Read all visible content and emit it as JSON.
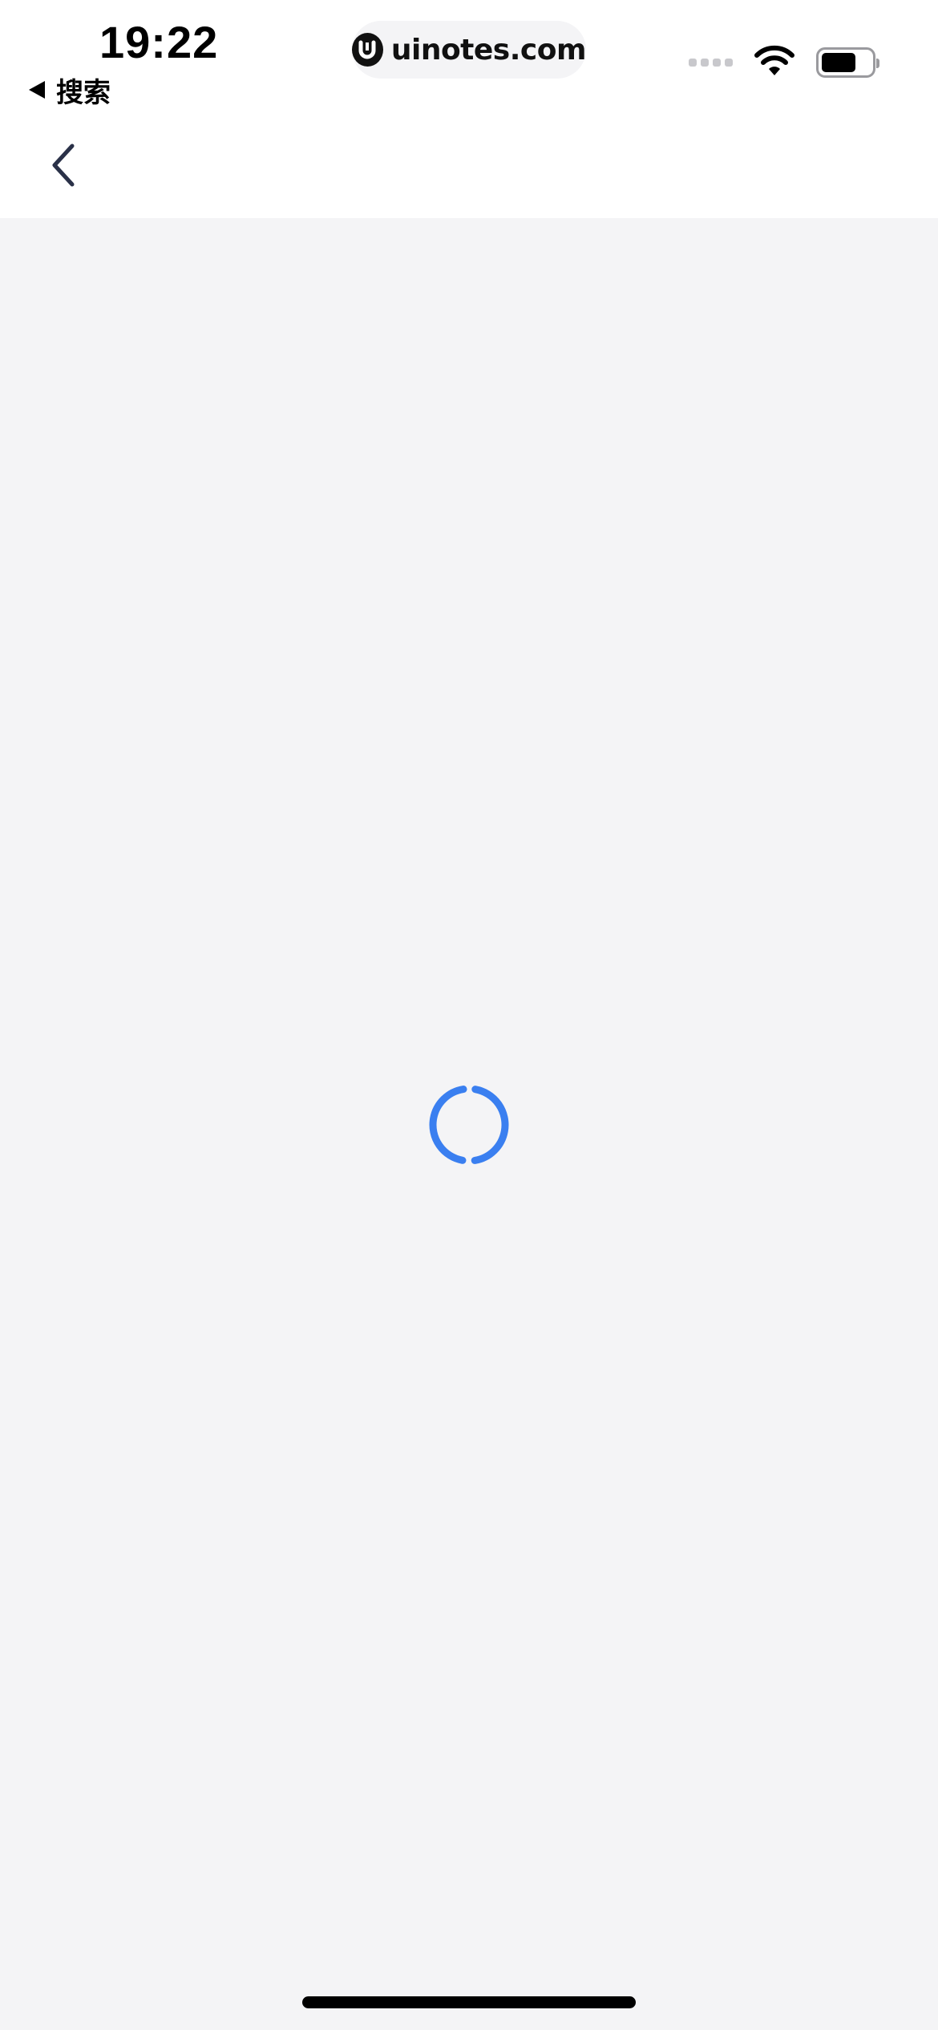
{
  "status_bar": {
    "time": "19:22",
    "back_app_label": "搜索",
    "url": "uinotes.com",
    "icons": [
      "cellular-signal-icon",
      "wifi-icon",
      "battery-icon"
    ]
  },
  "nav": {
    "back_icon": "chevron-left-icon"
  },
  "content": {
    "state": "loading",
    "spinner_icon": "loading-spinner-icon"
  },
  "colors": {
    "accent": "#3a7ff0",
    "nav_icon": "#2a3148",
    "background": "#f4f4f6",
    "header": "#ffffff"
  }
}
